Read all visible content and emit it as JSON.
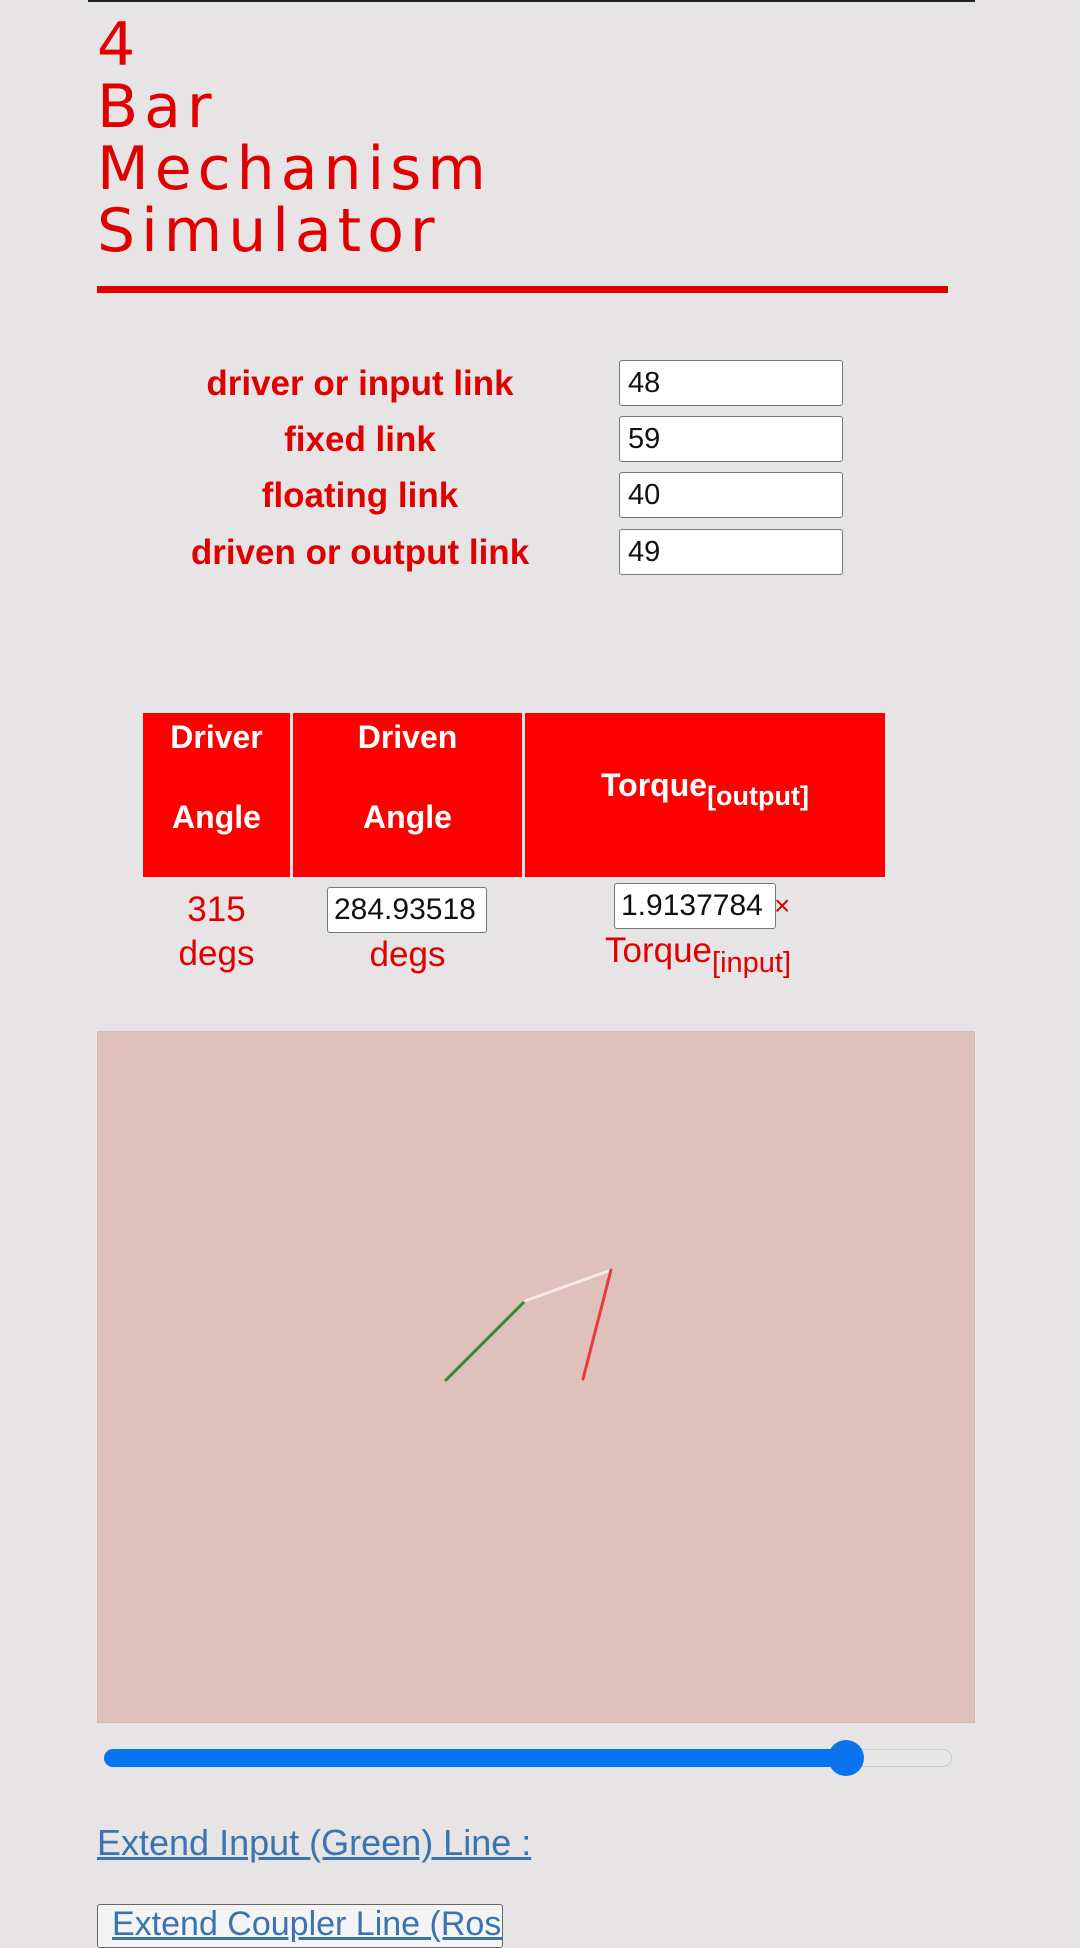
{
  "title": {
    "line1": "4",
    "line2": "Bar",
    "line3": "Mechanism",
    "line4": "Simulator"
  },
  "links": [
    {
      "label": "driver or input link",
      "value": "48"
    },
    {
      "label": "fixed link",
      "value": "59"
    },
    {
      "label": "floating link",
      "value": "40"
    },
    {
      "label": "driven or output link",
      "value": "49"
    }
  ],
  "table": {
    "driver_header_1": "Driver",
    "driver_header_2": "Angle",
    "driven_header_1": "Driven",
    "driven_header_2": "Angle",
    "torque_header": "Torque",
    "torque_header_sub": "[output]",
    "driver_angle": "315",
    "driver_unit": "degs",
    "driven_angle": "284.93518",
    "driven_unit": "degs",
    "torque_ratio": "1.9137784",
    "times": "×",
    "torque_input": "Torque",
    "torque_input_sub": "[input]"
  },
  "slider": {
    "value_fraction": 0.875
  },
  "links_colors": {
    "input": "#2e8b2e",
    "coupler": "#f5eaea",
    "output": "#e83a3a",
    "brand": "#e00000",
    "slider": "#0a74f0"
  },
  "extend_input_link": "Extend Input (Green) Line :",
  "extend_coupler_button": "Extend Coupler Line (Rose)"
}
